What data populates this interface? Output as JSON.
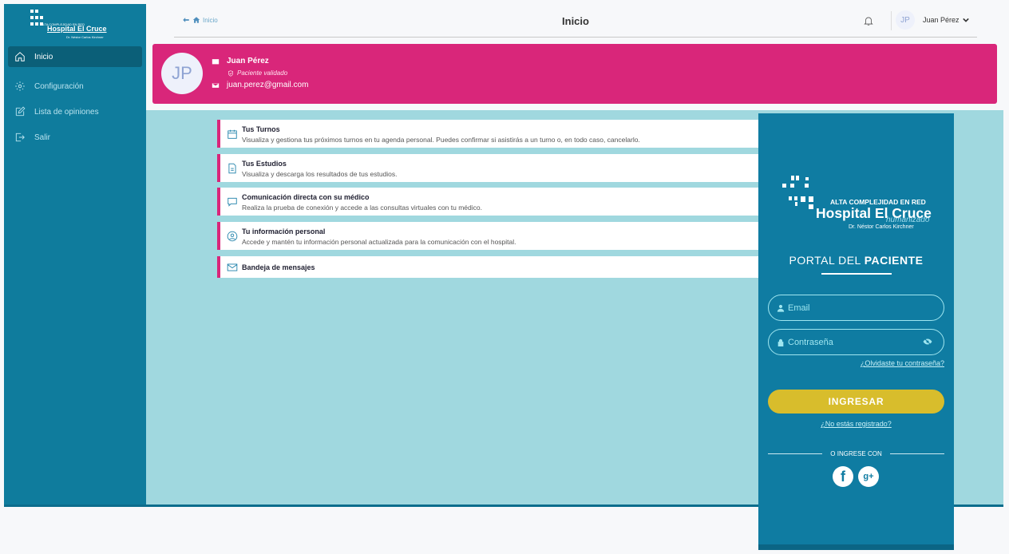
{
  "sidebar": {
    "logo": {
      "tagline": "ALTA COMPLEJIDAD EN RED",
      "name": "Hospital El Cruce",
      "doctor": "Dr. Néstor Carlos Kirchner"
    },
    "items": [
      {
        "label": "Inicio",
        "icon": "home-icon",
        "active": true
      },
      {
        "label": "Configuración",
        "icon": "gear-icon",
        "active": false
      },
      {
        "label": "Lista de opiniones",
        "icon": "edit-icon",
        "active": false
      },
      {
        "label": "Salir",
        "icon": "logout-icon",
        "active": false
      }
    ]
  },
  "header": {
    "breadcrumb": "Inicio",
    "title": "Inicio",
    "user": {
      "initials": "JP",
      "name": "Juan Pérez"
    }
  },
  "banner": {
    "initials": "JP",
    "name": "Juan Pérez",
    "status": "Paciente validado",
    "email": "juan.perez@gmail.com",
    "color": "#d9267a"
  },
  "menu": [
    {
      "title": "Tus Turnos",
      "description": "Visualiza y gestiona tus próximos turnos en tu agenda personal. Puedes confirmar si asistirás a un turno o, en todo caso, cancelarlo.",
      "icon": "calendar-icon"
    },
    {
      "title": "Tus Estudios",
      "description": "Visualiza y descarga los resultados de tus estudios.",
      "icon": "document-icon"
    },
    {
      "title": "Comunicación directa con su médico",
      "description": "Realiza la prueba de conexión y accede a las consultas virtuales con tu médico.",
      "icon": "chat-icon"
    },
    {
      "title": "Tu información personal",
      "description": "Accede y mantén tu información personal actualizada para la comunicación con el hospital.",
      "icon": "user-circle-icon"
    },
    {
      "title": "Bandeja de mensajes",
      "description": "",
      "icon": "mail-icon"
    }
  ],
  "login": {
    "logo": {
      "tagline": "ALTA COMPLEJIDAD EN RED",
      "name": "Hospital El Cruce",
      "humanizado": "humanizado",
      "doctor": "Dr. Néstor Carlos Kirchner"
    },
    "title_prefix": "PORTAL DEL",
    "title_bold": "PACIENTE",
    "email_placeholder": "Email",
    "password_placeholder": "Contraseña",
    "forgot": "¿Olvidaste tu contraseña?",
    "submit": "INGRESAR",
    "register": "¿No estás registrado?",
    "or_label": "O INGRESE CON",
    "social": [
      "f",
      "g+"
    ],
    "accent": "#d8bd2c",
    "panel_color": "#0f7ca2"
  },
  "colors": {
    "sidebar": "#0f7c9d",
    "main_bg": "#a0d8df",
    "accent": "#d9267a"
  }
}
